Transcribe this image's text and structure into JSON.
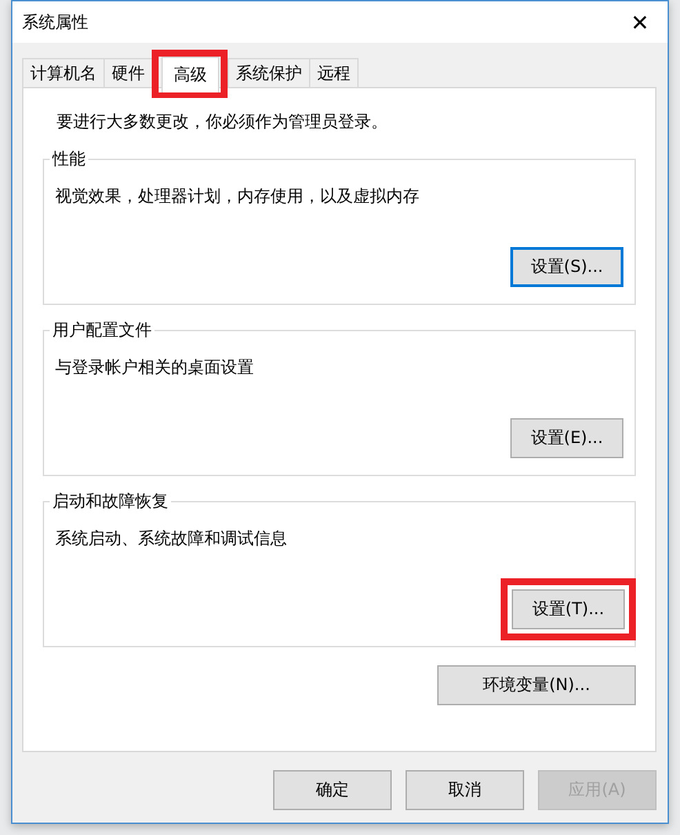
{
  "window": {
    "title": "系统属性",
    "close": "✕"
  },
  "tabs": [
    {
      "label": "计算机名",
      "selected": false,
      "highlighted": false
    },
    {
      "label": "硬件",
      "selected": false,
      "highlighted": false
    },
    {
      "label": "高级",
      "selected": true,
      "highlighted": true
    },
    {
      "label": "系统保护",
      "selected": false,
      "highlighted": false
    },
    {
      "label": "远程",
      "selected": false,
      "highlighted": false
    }
  ],
  "notice": "要进行大多数更改，你必须作为管理员登录。",
  "groups": [
    {
      "title": "性能",
      "description": "视觉效果，处理器计划，内存使用，以及虚拟内存",
      "button": {
        "label": "设置(S)...",
        "default": true,
        "highlighted": false
      }
    },
    {
      "title": "用户配置文件",
      "description": "与登录帐户相关的桌面设置",
      "button": {
        "label": "设置(E)...",
        "default": false,
        "highlighted": false
      }
    },
    {
      "title": "启动和故障恢复",
      "description": "系统启动、系统故障和调试信息",
      "button": {
        "label": "设置(T)...",
        "default": false,
        "highlighted": true
      }
    }
  ],
  "env_button": {
    "label": "环境变量(N)..."
  },
  "buttons": [
    {
      "label": "确定",
      "disabled": false
    },
    {
      "label": "取消",
      "disabled": false
    },
    {
      "label": "应用(A)",
      "disabled": true
    }
  ]
}
